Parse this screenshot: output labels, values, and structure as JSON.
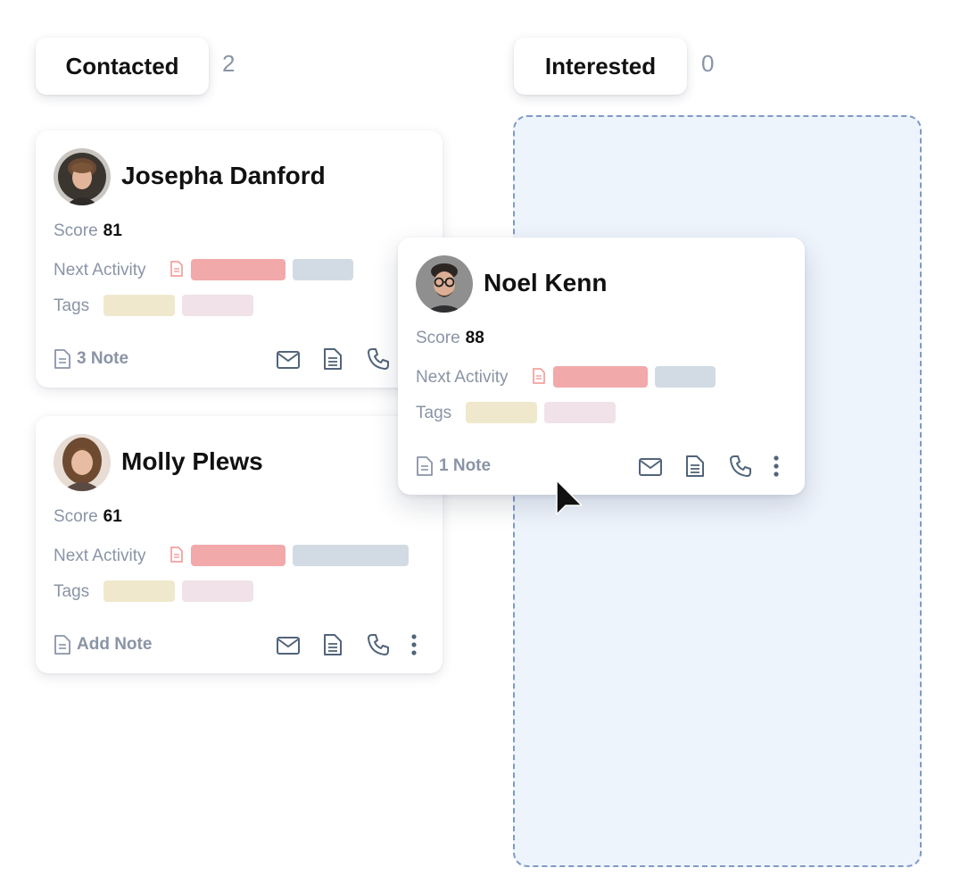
{
  "columns": [
    {
      "title": "Contacted",
      "count": "2"
    },
    {
      "title": "Interested",
      "count": "0"
    }
  ],
  "labels": {
    "score": "Score",
    "next_activity": "Next Activity",
    "tags": "Tags"
  },
  "cards": [
    {
      "name": "Josepha Danford",
      "score": "81",
      "note": "3 Note",
      "avatar": "avatar-photo"
    },
    {
      "name": "Molly Plews",
      "score": "61",
      "note": "Add Note",
      "avatar": "avatar-photo"
    },
    {
      "name": "Noel Kenn",
      "score": "88",
      "note": "1 Note",
      "avatar": "avatar-photo"
    }
  ],
  "icons": [
    "document-icon",
    "mail-icon",
    "file-icon",
    "phone-icon",
    "more-vertical-icon",
    "cursor-icon"
  ],
  "colors": {
    "accent_dashed": "#7f9ac9",
    "dropzone_bg": "#eef4fc",
    "activity_bar": "#f2a9aa",
    "neutral_bar": "#d2dbe3",
    "tag_yellow": "#f0e8cc",
    "tag_pink": "#f0e2e8",
    "muted_text": "#8a94a6"
  }
}
